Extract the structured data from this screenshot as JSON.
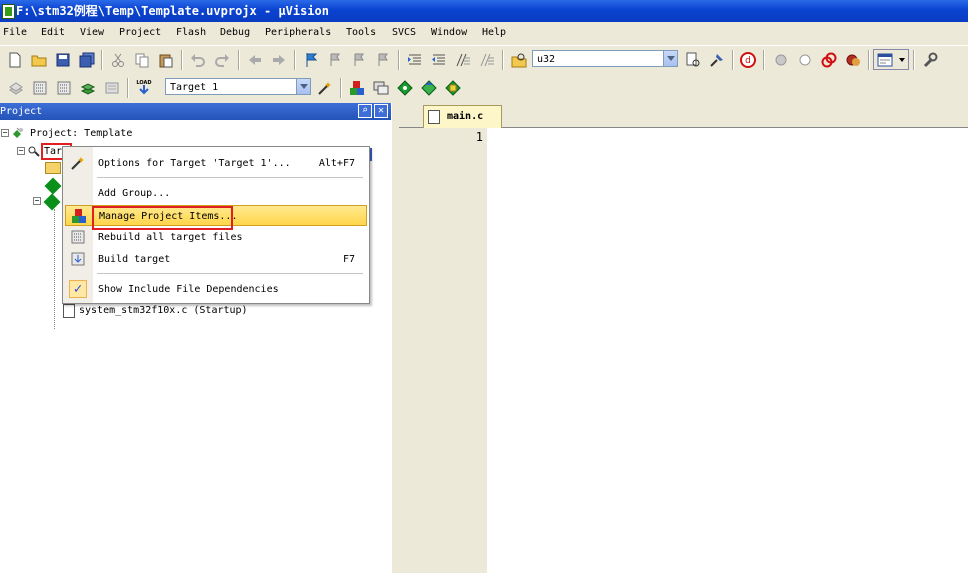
{
  "window": {
    "title": "F:\\stm32例程\\Temp\\Template.uvprojx - µVision"
  },
  "menubar": {
    "items": [
      "File",
      "Edit",
      "View",
      "Project",
      "Flash",
      "Debug",
      "Peripherals",
      "Tools",
      "SVCS",
      "Window",
      "Help"
    ]
  },
  "toolbar1": {
    "find_combo_value": "u32"
  },
  "toolbar2": {
    "target_combo_value": "Target 1"
  },
  "project_panel": {
    "title": "Project",
    "root_label": "Project: Template",
    "target_label": "Target 1",
    "visible_file": "system_stm32f10x.c (Startup)"
  },
  "editor": {
    "active_tab": "main.c",
    "line_number": "1"
  },
  "context_menu": {
    "options_label": "Options for Target 'Target 1'...",
    "options_shortcut": "Alt+F7",
    "add_group_label": "Add Group...",
    "manage_label": "Manage Project Items...",
    "rebuild_label": "Rebuild all target files",
    "build_label": "Build target",
    "build_shortcut": "F7",
    "show_deps_label": "Show Include File Dependencies"
  },
  "colors": {
    "title_bar": "#0a43d0",
    "highlight": "#ffd64a",
    "annotation_red": "#e02020"
  }
}
